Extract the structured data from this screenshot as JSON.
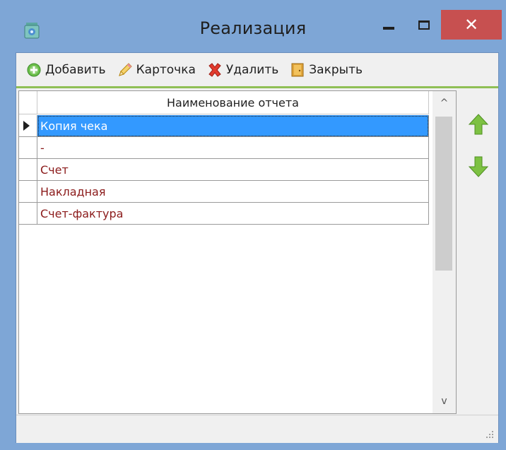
{
  "window": {
    "title": "Реализация",
    "minimize_icon": "minimize-icon",
    "maximize_icon": "maximize-icon",
    "close_glyph": "✕"
  },
  "toolbar": {
    "add_label": "Добавить",
    "card_label": "Карточка",
    "delete_label": "Удалить",
    "close_label": "Закрыть"
  },
  "grid": {
    "header": "Наименование отчета",
    "rows": [
      "Копия чека",
      "-",
      "Счет",
      "Накладная",
      "Счет-фактура"
    ],
    "selected_index": 0
  },
  "scrollbar": {
    "up_glyph": "^",
    "down_glyph": "v"
  },
  "colors": {
    "title_bar": "#7ea6d6",
    "close_button": "#c75050",
    "selection": "#3399ff",
    "row_text": "#8b1a1a",
    "arrow_green": "#7dc142",
    "toolbar_separator": "#8fbf55"
  }
}
